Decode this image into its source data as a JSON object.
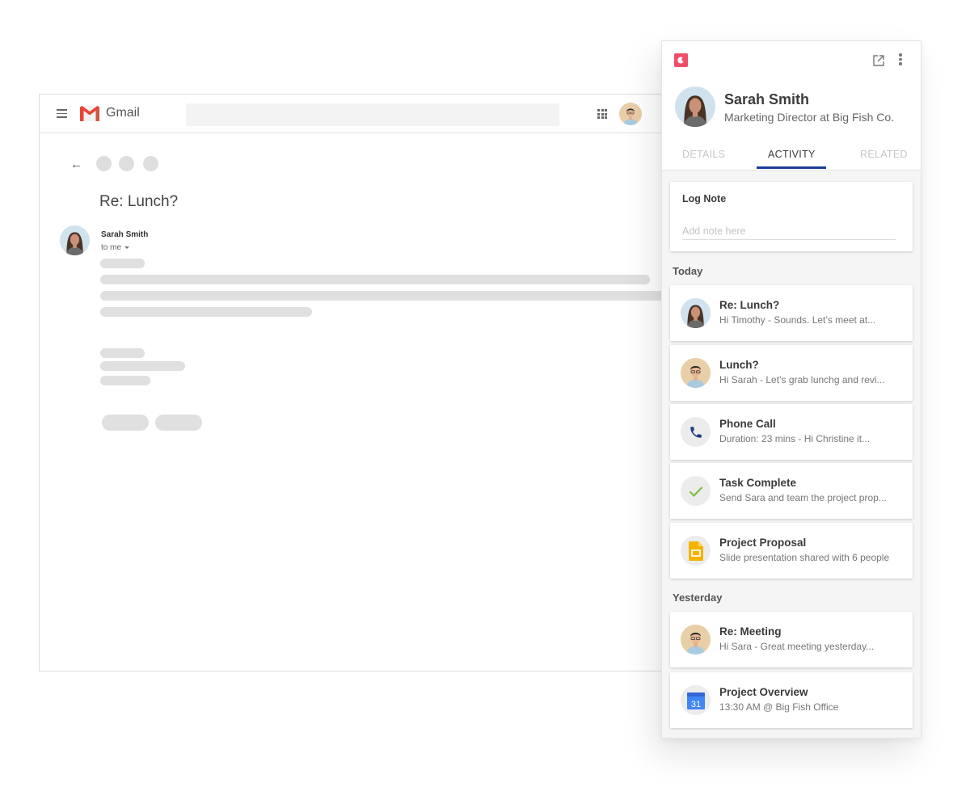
{
  "gmail": {
    "title": "Gmail",
    "search_placeholder": "",
    "subject": "Re: Lunch?",
    "sender": "Sarah Smith",
    "recipient": "to me",
    "brand_colors": {
      "red": "#ea4335",
      "dark_red": "#c5221f"
    }
  },
  "panel": {
    "brand_color": "#f04e6a",
    "contact": {
      "name": "Sarah Smith",
      "title": "Marketing Director at Big Fish Co."
    },
    "tabs": [
      {
        "label": "DETAILS",
        "active": false
      },
      {
        "label": "ACTIVITY",
        "active": true
      },
      {
        "label": "RELATED",
        "active": false
      }
    ],
    "accent_color": "#1a3d9b",
    "log_note": {
      "title": "Log Note",
      "placeholder": "Add note here",
      "value": ""
    },
    "sections": [
      {
        "label": "Today",
        "items": [
          {
            "icon": "avatar-sarah",
            "title": "Re: Lunch?",
            "subtitle": "Hi Timothy -  Sounds. Let’s meet at..."
          },
          {
            "icon": "avatar-timothy",
            "title": "Lunch?",
            "subtitle": "Hi Sarah - Let’s grab lunchg and revi..."
          },
          {
            "icon": "phone-icon",
            "title": "Phone Call",
            "subtitle": "Duration: 23 mins -  Hi Christine it..."
          },
          {
            "icon": "check-icon",
            "title": "Task Complete",
            "subtitle": "Send Sara and team the project prop..."
          },
          {
            "icon": "slides-icon",
            "title": "Project Proposal",
            "subtitle": "Slide presentation shared with 6 people"
          }
        ]
      },
      {
        "label": "Yesterday",
        "items": [
          {
            "icon": "avatar-timothy",
            "title": "Re: Meeting",
            "subtitle": "Hi Sara - Great meeting yesterday..."
          },
          {
            "icon": "calendar-icon",
            "title": "Project Overview",
            "subtitle": "13:30 AM @ Big Fish Office",
            "calendar_day": "31"
          }
        ]
      }
    ]
  }
}
